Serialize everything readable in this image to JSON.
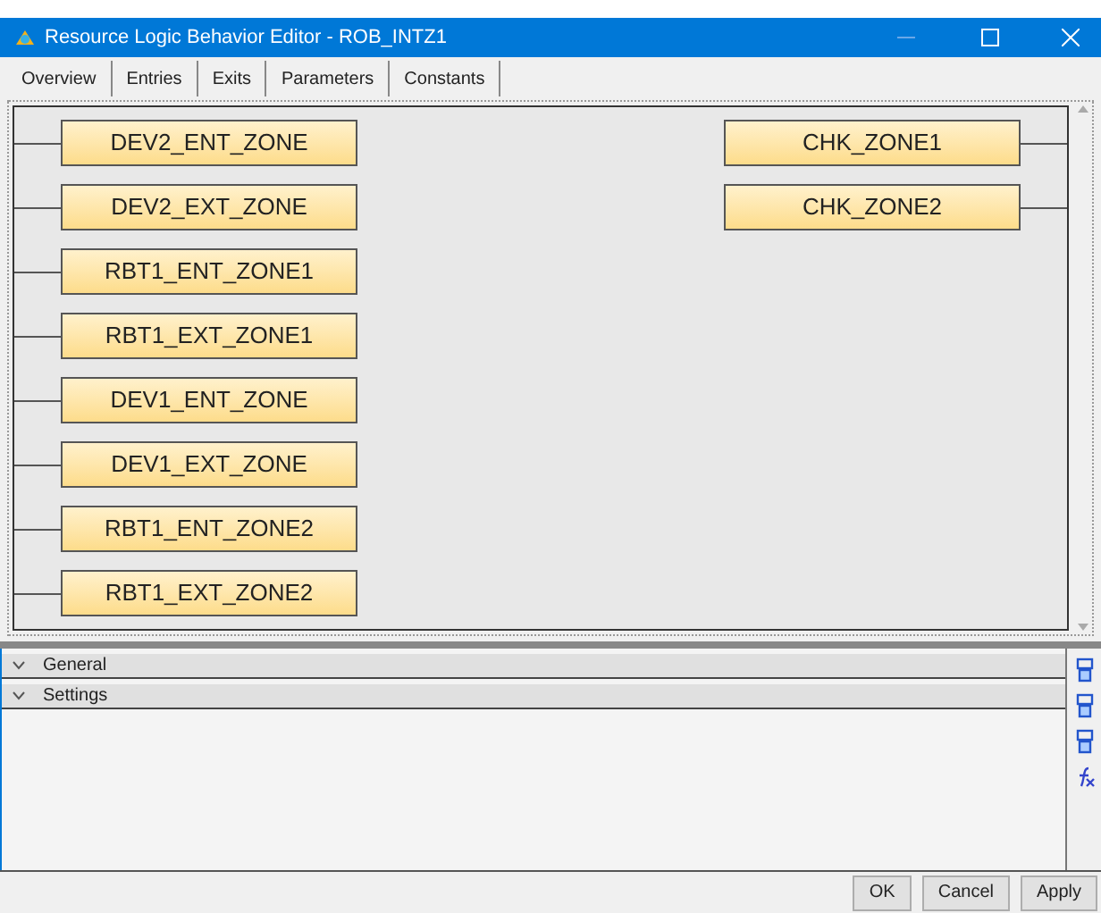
{
  "window": {
    "title": "Resource Logic Behavior Editor - ROB_INTZ1"
  },
  "tabs": [
    "Overview",
    "Entries",
    "Exits",
    "Parameters",
    "Constants"
  ],
  "entry_nodes": [
    "DEV2_ENT_ZONE",
    "DEV2_EXT_ZONE",
    "RBT1_ENT_ZONE1",
    "RBT1_EXT_ZONE1",
    "DEV1_ENT_ZONE",
    "DEV1_EXT_ZONE",
    "RBT1_ENT_ZONE2",
    "RBT1_EXT_ZONE2"
  ],
  "exit_nodes": [
    "CHK_ZONE1",
    "CHK_ZONE2"
  ],
  "sections": [
    {
      "label": "General"
    },
    {
      "label": "Settings"
    }
  ],
  "buttons": [
    "OK",
    "Cancel",
    "Apply"
  ]
}
